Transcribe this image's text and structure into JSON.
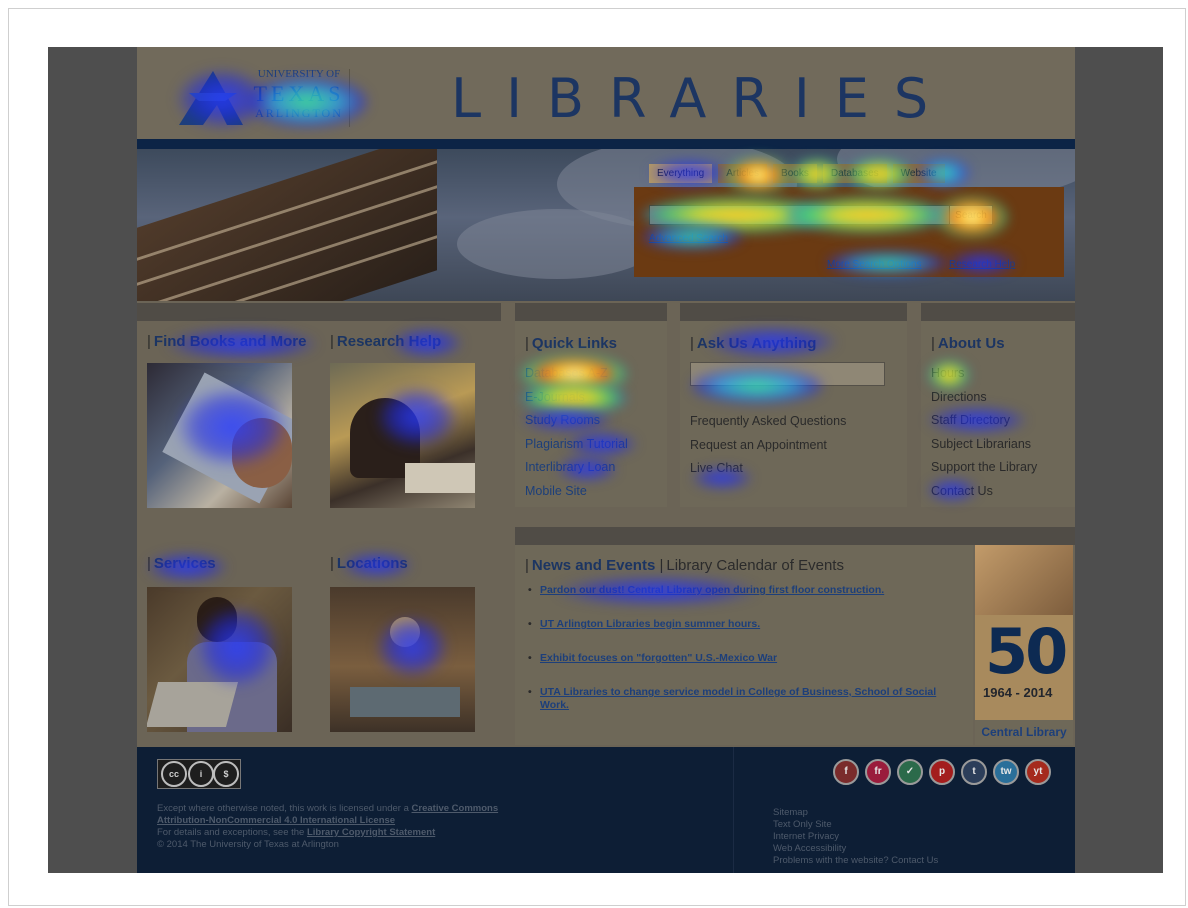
{
  "brand": {
    "university_line1": "UNIVERSITY OF",
    "university_line2": "TEXAS",
    "university_line3": "ARLINGTON",
    "libraries": "LIBRARIES",
    "accent": "#1c3562"
  },
  "search": {
    "tabs": [
      "Everything",
      "Articles",
      "Books",
      "Databases",
      "Website"
    ],
    "input_value": "",
    "button": "Search",
    "links": [
      "Advanced Search",
      "More Search Options",
      "Research Help"
    ]
  },
  "columns": {
    "find_books": "Find Books and More",
    "research_help": "Research Help",
    "services": "Services",
    "locations": "Locations",
    "quick_links": {
      "title": "Quick Links",
      "items": [
        "Databases A-Z",
        "E-Journals",
        "Study Rooms",
        "Plagiarism Tutorial",
        "Interlibrary Loan",
        "Mobile Site"
      ]
    },
    "ask": {
      "title": "Ask Us Anything",
      "items": [
        "Frequently Asked Questions",
        "Request an Appointment",
        "Live Chat"
      ]
    },
    "about": {
      "title": "About Us",
      "items": [
        "Hours",
        "Directions",
        "Staff Directory",
        "Subject Librarians",
        "Support the Library",
        "Contact Us"
      ]
    }
  },
  "news": {
    "title": "News and Events",
    "calendar": "Library Calendar of Events",
    "items": [
      "Pardon our dust! Central Library open during first floor construction.",
      "UT Arlington Libraries begin summer hours.",
      "Exhibit focuses on \"forgotten\" U.S.-Mexico War",
      "UTA Libraries to change service model in College of Business, School of Social Work."
    ]
  },
  "anniversary": {
    "number": "50",
    "years": "1964 - 2014",
    "label": "Central Library"
  },
  "footer": {
    "license_prefix": "Except where otherwise noted, this work is licensed under a",
    "license_link": "Creative Commons Attribution-NonCommercial 4.0 International License",
    "details_prefix": "For details and exceptions, see the",
    "details_link": "Library Copyright Statement",
    "copyright": "© 2014 The University of Texas at Arlington",
    "links": [
      "Sitemap",
      "Text Only Site",
      "Internet Privacy",
      "Web Accessibility",
      "Problems with the website? Contact Us"
    ],
    "social": [
      "f",
      "fr",
      "✓",
      "p",
      "t",
      "tw",
      "yt"
    ]
  }
}
